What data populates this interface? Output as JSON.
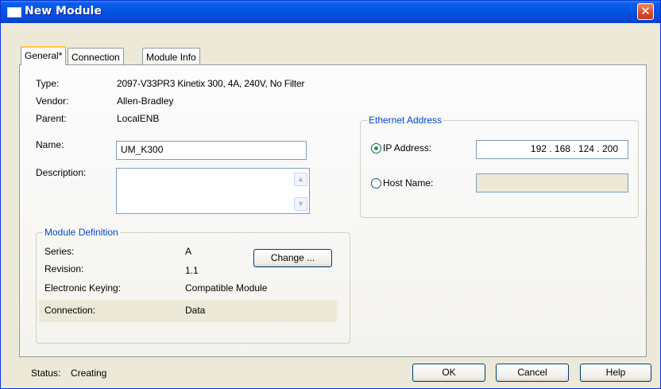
{
  "window": {
    "title": "New Module",
    "close_glyph": "✕"
  },
  "tabs": [
    {
      "label": "General*"
    },
    {
      "label": "Connection"
    },
    {
      "label": "Module Info"
    }
  ],
  "general": {
    "type_label": "Type:",
    "type_value": "2097-V33PR3 Kinetix 300, 4A, 240V, No Filter",
    "vendor_label": "Vendor:",
    "vendor_value": "Allen-Bradley",
    "parent_label": "Parent:",
    "parent_value": "LocalENB",
    "name_label": "Name:",
    "name_value": "UM_K300",
    "description_label": "Description:",
    "description_value": ""
  },
  "module_definition": {
    "title": "Module Definition",
    "series_label": "Series:",
    "series_value": "A",
    "revision_label": "Revision:",
    "revision_value": "1.1",
    "keying_label": "Electronic Keying:",
    "keying_value": "Compatible Module",
    "connection_label": "Connection:",
    "connection_value": "Data",
    "change_button": "Change ..."
  },
  "ethernet": {
    "title": "Ethernet Address",
    "ip_label": "IP Address:",
    "ip_value": "192  .  168  .  124  .  200",
    "ip_selected": true,
    "host_label": "Host Name:",
    "host_value": ""
  },
  "footer": {
    "status_label": "Status:",
    "status_value": "Creating",
    "ok": "OK",
    "cancel": "Cancel",
    "help": "Help"
  },
  "icons": {
    "scroll_up": "▲",
    "scroll_down": "▼"
  }
}
